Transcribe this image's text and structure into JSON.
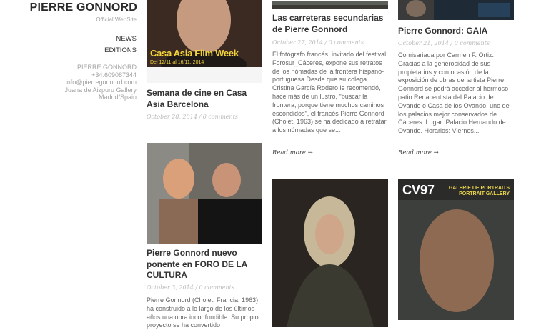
{
  "site": {
    "title": "PIERRE GONNORD",
    "subtitle": "Official WebSite"
  },
  "nav": [
    "NEWS",
    "EDITIONS"
  ],
  "contact": {
    "name": "PIERRE GONNORD",
    "phone": "+34.609087344",
    "email": "info@pierregonnord.com",
    "gallery": "Juana de Aizpuru Gallery",
    "city": "Madrid/Spain"
  },
  "posts": [
    {
      "title": "Semana de cine en Casa Asia Barcelona",
      "date": "October 28, 2014",
      "comments": "0 comments",
      "poster_title": "Casa Asia Film Week",
      "poster_dates": "Del 12/11 al 16/11, 2014"
    },
    {
      "title": "Pierre Gonnord nuevo ponente en FORO DE LA CULTURA",
      "date": "October 3, 2014",
      "comments": "0 comments",
      "excerpt": "Pierre Gonnord (Cholet, Francia, 1963) ha construido a lo largo de los últimos años una obra inconfundible. Su propio proyecto se ha convertido"
    },
    {
      "title": "Las carreteras secundarias de Pierre Gonnord",
      "date": "October 27, 2014",
      "comments": "0 comments",
      "excerpt": "El fotógrafo francés, invitado del festival Forosur_Cáceres, expone sus retratos de los nómadas de la frontera hispano-portuguesa Desde que su colega Cristina García Rodero le recomendó, hace más de un lustro, \"buscar la frontera, porque tiene muchos caminos escondidos\", el francés Pierre Gonnord (Cholet, 1963) se ha dedicado a retratar a los nómadas que se...",
      "read_more": "Read more →"
    },
    {
      "title": "Pierre Gonnord: GAIA",
      "date": "October 21, 2014",
      "comments": "0 comments",
      "excerpt": "Comisariada por Carmen F. Ortiz. Gracias a la generosidad de sus propietarios y con ocasión de la exposición de obras del artista Pierre Gonnord se podrá acceder al hermoso patio Renacentista del Palacio de Ovando o Casa de los Ovando, uno de los palacios mejor conservados de Cáceres. Lugar: Palacio Hernando de Ovando. Horarios: Viernes...",
      "read_more": "Read more →"
    },
    {
      "cover_logo": "CV97",
      "cover_tag1": "GALERIE DE PORTRAITS",
      "cover_tag2": "PORTRAIT GALLERY"
    }
  ],
  "colors": {
    "background": "#ffffff",
    "title_text": "#333333",
    "meta_text": "#bbbbbb",
    "poster_yellow": "#f3d33a"
  }
}
